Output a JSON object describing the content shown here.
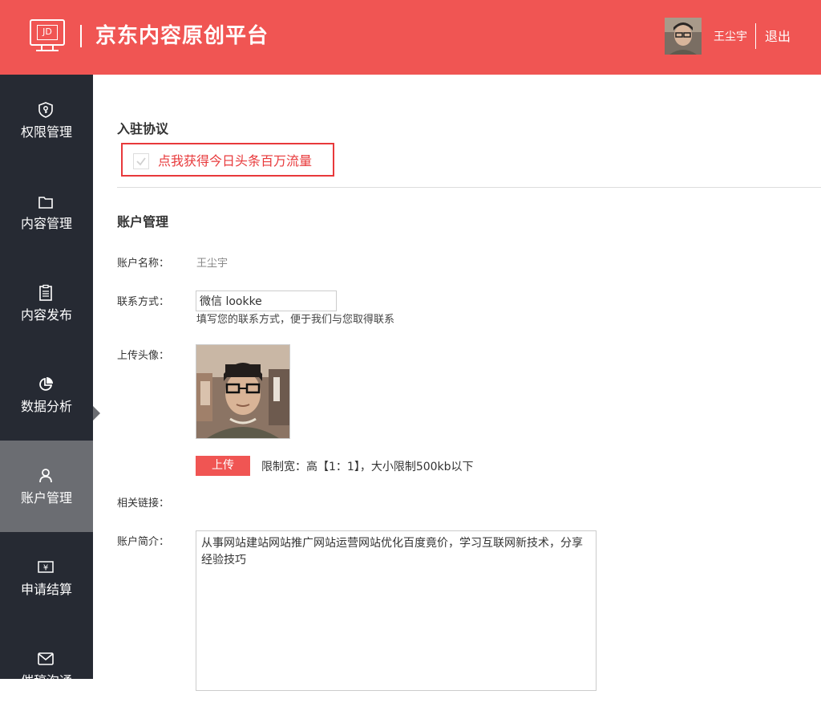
{
  "header": {
    "logo_text": "JD",
    "site_title": "京东内容原创平台",
    "username": "王尘宇",
    "logout_label": "退出",
    "bg_color": "#f05553"
  },
  "sidebar": {
    "items": [
      {
        "label": "权限管理",
        "icon": "shield-key-icon",
        "active": false
      },
      {
        "label": "内容管理",
        "icon": "folder-icon",
        "active": false
      },
      {
        "label": "内容发布",
        "icon": "clipboard-icon",
        "active": false
      },
      {
        "label": "数据分析",
        "icon": "pie-chart-icon",
        "active": false
      },
      {
        "label": "账户管理",
        "icon": "user-icon",
        "active": true
      },
      {
        "label": "申请结算",
        "icon": "yuan-ticket-icon",
        "active": false
      },
      {
        "label": "催稿沟通",
        "icon": "mail-icon",
        "active": false
      }
    ]
  },
  "agreement": {
    "title": "入驻协议",
    "checkbox_label": "点我获得今日头条百万流量",
    "checked": true
  },
  "account": {
    "title": "账户管理",
    "name_label": "账户名称：",
    "name_value": "王尘宇",
    "contact_label": "联系方式：",
    "contact_value": "微信 lookke",
    "contact_hint": "填写您的联系方式，便于我们与您取得联系",
    "avatar_label": "上传头像：",
    "upload_label": "上传",
    "upload_hint": "限制宽：高【1：1】，大小限制500kb以下",
    "links_label": "相关链接：",
    "bio_label": "账户简介：",
    "bio_value": "从事网站建站网站推广网站运营网站优化百度竟价，学习互联网新技术，分享经验技巧"
  }
}
